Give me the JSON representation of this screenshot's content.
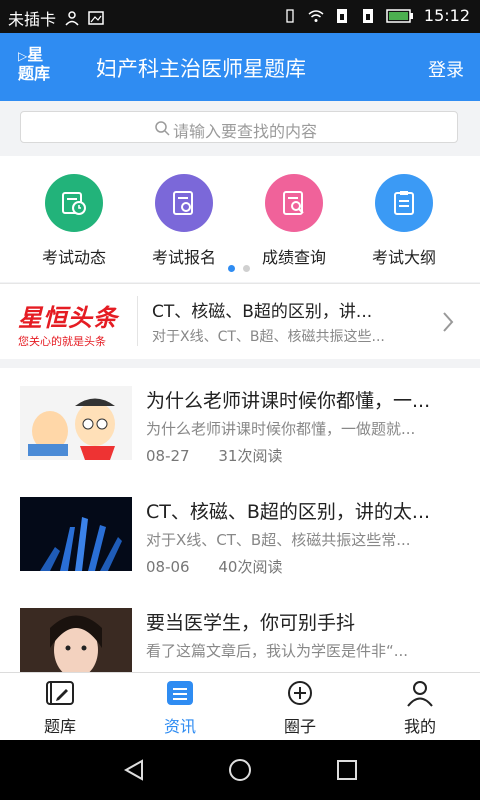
{
  "status": {
    "carrier": "未插卡",
    "time": "15:12"
  },
  "header": {
    "logo_line1": "星",
    "logo_line2": "题库",
    "title": "妇产科主治医师星题库",
    "login": "登录"
  },
  "search": {
    "placeholder": "请输入要查找的内容"
  },
  "quick": [
    {
      "label": "考试动态",
      "color": "#22b37a",
      "icon": "news-icon"
    },
    {
      "label": "考试报名",
      "color": "#7b68d9",
      "icon": "certificate-icon"
    },
    {
      "label": "成绩查询",
      "color": "#f0629a",
      "icon": "search-doc-icon"
    },
    {
      "label": "考试大纲",
      "color": "#3b9af5",
      "icon": "clipboard-icon"
    }
  ],
  "banner": {
    "brand_title": "星恒头条",
    "brand_slogan": "您关心的就是头条",
    "title": "CT、核磁、B超的区别，讲...",
    "subtitle": "对于X线、CT、B超、核磁共振这些..."
  },
  "articles": [
    {
      "title": "为什么老师讲课时候你都懂，一...",
      "subtitle": "为什么老师讲课时候你都懂，一做题就...",
      "date": "08-27",
      "reads": "31次阅读"
    },
    {
      "title": "CT、核磁、B超的区别，讲的太...",
      "subtitle": "对于X线、CT、B超、核磁共振这些常...",
      "date": "08-06",
      "reads": "40次阅读"
    },
    {
      "title": "要当医学生，你可别手抖",
      "subtitle": "看了这篇文章后，我认为学医是件非“..."
    }
  ],
  "tabs": [
    {
      "label": "题库"
    },
    {
      "label": "资讯"
    },
    {
      "label": "圈子"
    },
    {
      "label": "我的"
    }
  ],
  "accent_color": "#2f8cf2"
}
